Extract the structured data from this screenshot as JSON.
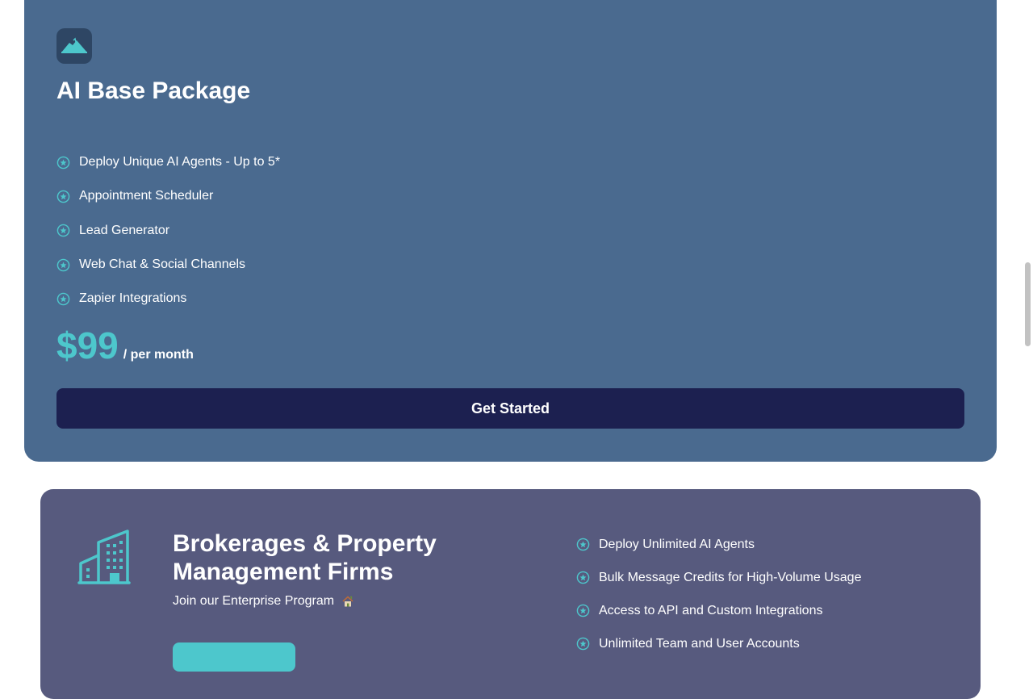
{
  "base_package": {
    "title": "AI Base Package",
    "features": [
      "Deploy Unique AI Agents - Up to 5*",
      "Appointment Scheduler",
      "Lead Generator",
      "Web Chat & Social Channels",
      "Zapier Integrations"
    ],
    "price": "$99",
    "price_period": "/ per month",
    "cta_label": "Get Started"
  },
  "enterprise": {
    "title": "Brokerages & Property Management Firms",
    "subtitle": "Join our Enterprise Program",
    "features": [
      "Deploy Unlimited AI Agents",
      "Bulk Message Credits for High-Volume Usage",
      "Access to API and Custom Integrations",
      "Unlimited Team and User Accounts"
    ]
  },
  "colors": {
    "base_card_bg": "#4a6a8f",
    "enterprise_card_bg": "#575a7e",
    "accent_teal": "#4dc7cc",
    "cta_bg": "#1c2050"
  },
  "icons": {
    "logo": "house-roof-icon",
    "bullet": "star-circle-icon",
    "building": "office-building-icon",
    "house_emoji": "house-icon"
  }
}
